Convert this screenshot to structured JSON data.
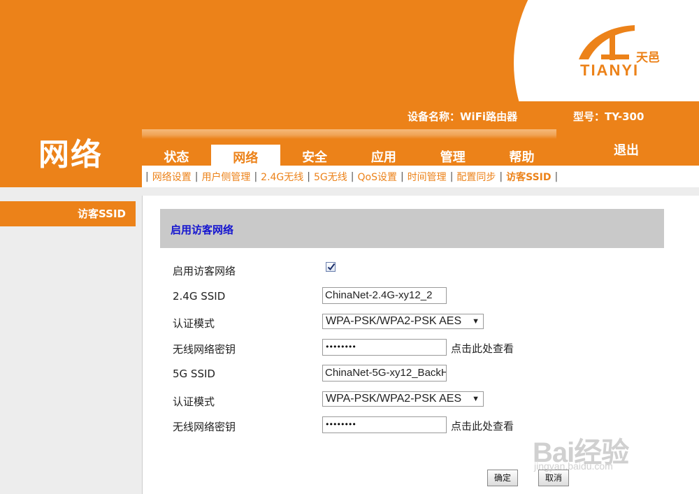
{
  "brand": {
    "logo_word": "TIANYI",
    "logo_cn": "天邑"
  },
  "header": {
    "section_title": "网络",
    "device_label": "设备名称：WiFi路由器",
    "model_label": "型号：TY-300",
    "logout_label": "退出"
  },
  "tabs": [
    "状态",
    "网络",
    "安全",
    "应用",
    "管理",
    "帮助"
  ],
  "active_tab": "网络",
  "subnav": [
    "网络设置",
    "用户侧管理",
    "2.4G无线",
    "5G无线",
    "QoS设置",
    "时间管理",
    "配置同步",
    "访客SSID"
  ],
  "active_subnav": "访客SSID",
  "sidebar": {
    "items": [
      {
        "label": "访客SSID"
      }
    ]
  },
  "panel": {
    "title": "启用访客网络",
    "enable_label": "启用访客网络",
    "enable_checked": true,
    "ssid24_label": "2.4G SSID",
    "ssid24_value": "ChinaNet-2.4G-xy12_2",
    "auth24_label": "认证模式",
    "auth24_value": "WPA-PSK/WPA2-PSK AES",
    "pwd24_label": "无线网络密钥",
    "pwd24_value": "••••••••",
    "pwd24_show": "点击此处查看",
    "ssid5_label": "5G SSID",
    "ssid5_value": "ChinaNet-5G-xy12_BackH",
    "auth5_label": "认证模式",
    "auth5_value": "WPA-PSK/WPA2-PSK AES",
    "pwd5_label": "无线网络密钥",
    "pwd5_value": "••••••••",
    "pwd5_show": "点击此处查看"
  },
  "buttons": {
    "confirm": "确定",
    "cancel": "取消"
  },
  "watermark": {
    "text": "Bai经验",
    "url": "jingyan.baidu.com"
  },
  "colors": {
    "brand_orange": "#ec8219",
    "title_blue": "#1515d0",
    "panel_gray": "#c9c9c9"
  }
}
